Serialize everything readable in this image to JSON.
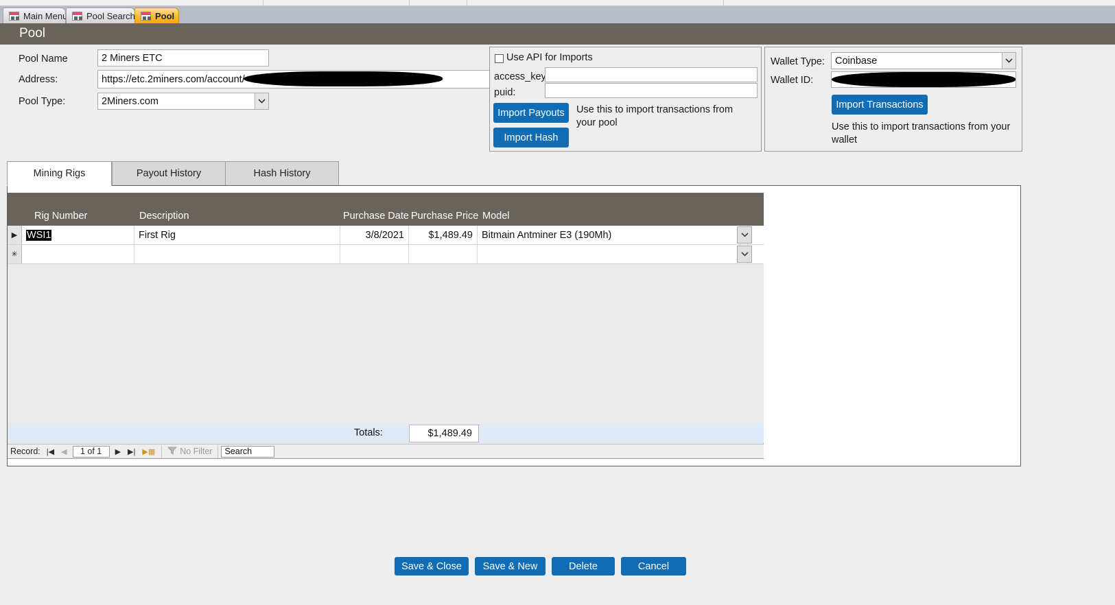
{
  "window": {
    "title": "Pool"
  },
  "doc_tabs": [
    {
      "label": "Main Menu",
      "active": false
    },
    {
      "label": "Pool Search",
      "active": false
    },
    {
      "label": "Pool",
      "active": true
    }
  ],
  "form": {
    "pool_name_label": "Pool Name",
    "pool_name_value": "2 Miners ETC",
    "address_label": "Address:",
    "address_value": "https://etc.2miners.com/account/",
    "pool_type_label": "Pool Type:",
    "pool_type_value": "2Miners.com"
  },
  "api_panel": {
    "use_api_label": "Use API for Imports",
    "use_api_checked": false,
    "access_key_label": "access_key:",
    "access_key_value": "",
    "access_key_placeholder": "",
    "puid_label": "puid:",
    "puid_value": "",
    "puid_placeholder": "",
    "import_payouts_label": "Import Payouts",
    "import_hash_label": "Import Hash",
    "help_text": "Use this to import transactions from your pool"
  },
  "wallet_panel": {
    "wallet_type_label": "Wallet Type:",
    "wallet_type_value": "Coinbase",
    "wallet_id_label": "Wallet ID:",
    "wallet_id_value": "",
    "import_transactions_label": "Import Transactions",
    "help_text": "Use this to import transactions from your wallet"
  },
  "page_tabs": [
    {
      "label": "Mining Rigs",
      "active": true
    },
    {
      "label": "Payout History",
      "active": false
    },
    {
      "label": "Hash History",
      "active": false
    }
  ],
  "datasheet": {
    "columns": [
      "Rig Number",
      "Description",
      "Purchase Date",
      "Purchase Price",
      "Model"
    ],
    "rows": [
      {
        "rig_number": "WSI1",
        "description": "First Rig",
        "purchase_date": "3/8/2021",
        "purchase_price": "$1,489.49",
        "model": "Bitmain Antminer E3 (190Mh)",
        "selected": true
      }
    ],
    "new_row_marker": "✳",
    "current_row_marker": "▶",
    "totals_label": "Totals:",
    "totals_value": "$1,489.49"
  },
  "record_nav": {
    "record_label": "Record:",
    "first_icon": "first-record-icon",
    "prev_icon": "previous-record-icon",
    "position": "1 of 1",
    "next_icon": "next-record-icon",
    "last_icon": "last-record-icon",
    "new_icon": "new-record-icon",
    "filter_label": "No Filter",
    "search_value": "Search"
  },
  "footer_buttons": [
    {
      "label": "Save & Close"
    },
    {
      "label": "Save & New"
    },
    {
      "label": "Delete"
    },
    {
      "label": "Cancel"
    }
  ],
  "colors": {
    "accent_blue": "#0f6cb5",
    "header_brown": "#69635c",
    "active_tab_orange": "#fcb836",
    "totals_row_blue": "#dfeaf9"
  }
}
